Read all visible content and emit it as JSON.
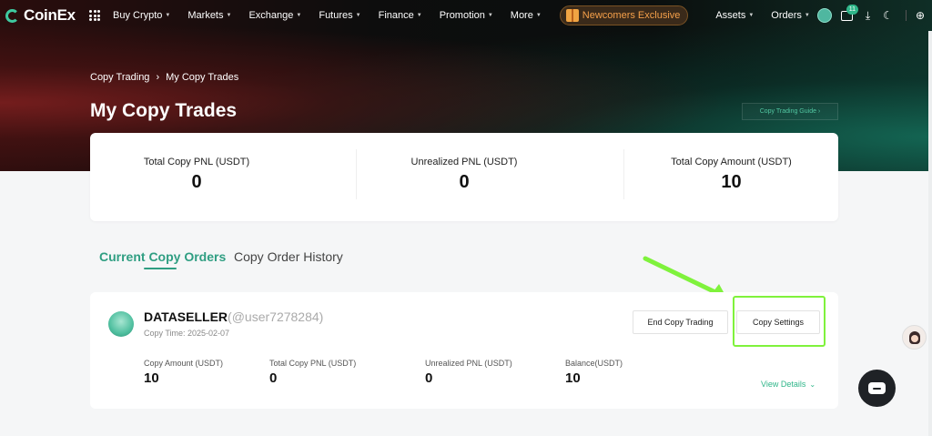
{
  "brand": {
    "name": "CoinEx",
    "accent": "#2f9e82",
    "highlight": "#7ff23c"
  },
  "nav": {
    "items": [
      {
        "label": "Buy Crypto"
      },
      {
        "label": "Markets"
      },
      {
        "label": "Exchange"
      },
      {
        "label": "Futures"
      },
      {
        "label": "Finance"
      },
      {
        "label": "Promotion"
      },
      {
        "label": "More"
      }
    ],
    "promo_label": "Newcomers Exclusive",
    "assets_label": "Assets",
    "orders_label": "Orders",
    "message_count": "11"
  },
  "breadcrumb": {
    "parent": "Copy Trading",
    "current": "My Copy Trades"
  },
  "page_title": "My Copy Trades",
  "guide_link": "Copy Trading Guide ›",
  "summary": {
    "total_pnl_label": "Total Copy PNL (USDT)",
    "total_pnl_value": "0",
    "unrealized_pnl_label": "Unrealized PNL (USDT)",
    "unrealized_pnl_value": "0",
    "total_amount_label": "Total Copy Amount (USDT)",
    "total_amount_value": "10"
  },
  "tabs": {
    "current": "Current Copy Orders",
    "history": "Copy Order History"
  },
  "order": {
    "trader_name": "DATASELLER",
    "trader_handle": "(@user7278284)",
    "copy_time": "Copy Time: 2025-02-07",
    "end_button": "End Copy Trading",
    "settings_button": "Copy Settings",
    "copy_amount_label": "Copy Amount (USDT)",
    "copy_amount_value": "10",
    "total_pnl_label": "Total Copy PNL (USDT)",
    "total_pnl_value": "0",
    "unrealized_pnl_label": "Unrealized PNL (USDT)",
    "unrealized_pnl_value": "0",
    "balance_label": "Balance(USDT)",
    "balance_value": "10",
    "view_details": "View Details"
  },
  "icons": [
    "apps-icon",
    "gift-icon",
    "message-icon",
    "download-icon",
    "moon-icon",
    "globe-icon",
    "chevron-right-icon",
    "chevron-down-icon",
    "chat-icon"
  ]
}
